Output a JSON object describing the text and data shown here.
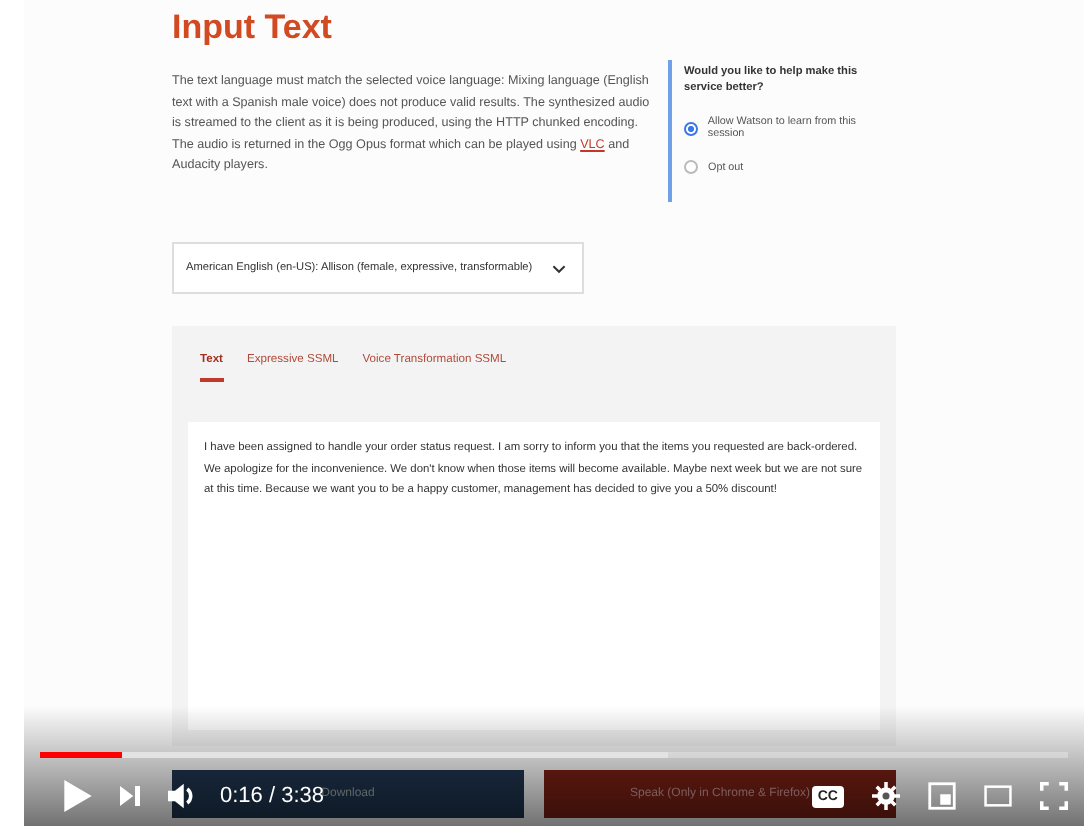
{
  "page": {
    "title": "Input Text",
    "intro": {
      "before": "The text language must match the selected voice language: Mixing language (English text with a Spanish male voice) does not produce valid results. The synthesized audio is streamed to the client as it is being produced, using the HTTP chunked encoding. The audio is returned in the Ogg Opus format which can be played using ",
      "link": "VLC",
      "after": " and Audacity players."
    },
    "feedback": {
      "question": "Would you like to help make this service better?",
      "options": [
        {
          "label": "Allow Watson to learn from this session",
          "selected": true
        },
        {
          "label": "Opt out",
          "selected": false
        }
      ]
    },
    "voice_select": {
      "value": "American English (en-US): Allison (female, expressive, transformable)"
    },
    "tabs": [
      {
        "label": "Text",
        "selected": true
      },
      {
        "label": "Expressive SSML",
        "selected": false
      },
      {
        "label": "Voice Transformation SSML",
        "selected": false
      }
    ],
    "text_input": {
      "value": "I have been assigned to handle your order status request. I am sorry to inform you that the items you requested are back-ordered. We apologize for the inconvenience. We don't know when those items will become available. Maybe next week but we are not sure at this time. Because we want you to be a happy customer, management has decided to give you a 50% discount!"
    },
    "buttons": [
      {
        "label": "Download",
        "kind": "secondary"
      },
      {
        "label": "Speak   (Only in Chrome & Firefox)",
        "kind": "primary"
      }
    ]
  },
  "player": {
    "progress": {
      "level": 0.079
    },
    "buffered": {
      "level": 0.61
    },
    "time": "0:16 / 3:38",
    "captions_label": "CC"
  }
}
